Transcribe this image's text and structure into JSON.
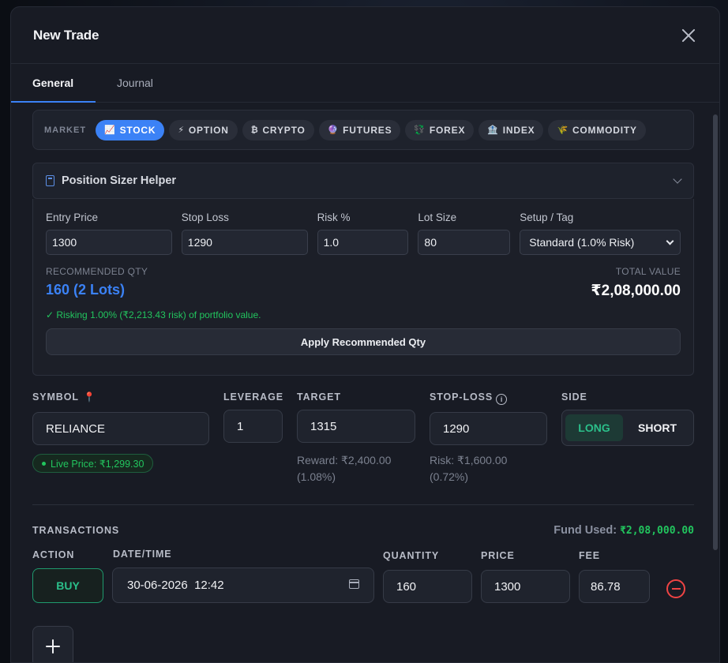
{
  "modal": {
    "title": "New Trade"
  },
  "tabs": [
    {
      "label": "General",
      "active": true
    },
    {
      "label": "Journal",
      "active": false
    }
  ],
  "market": {
    "label": "MARKET",
    "options": [
      {
        "label": "STOCK",
        "icon": "chart-icon",
        "glyph": "📈",
        "active": true
      },
      {
        "label": "OPTION",
        "icon": "lightning-icon",
        "glyph": "⚡",
        "active": false
      },
      {
        "label": "CRYPTO",
        "icon": "bitcoin-icon",
        "glyph": "₿",
        "active": false
      },
      {
        "label": "FUTURES",
        "icon": "crystal-ball-icon",
        "glyph": "🔮",
        "active": false
      },
      {
        "label": "FOREX",
        "icon": "currency-exchange-icon",
        "glyph": "💱",
        "active": false
      },
      {
        "label": "INDEX",
        "icon": "bank-icon",
        "glyph": "🏦",
        "active": false
      },
      {
        "label": "COMMODITY",
        "icon": "wheat-icon",
        "glyph": "🌾",
        "active": false
      }
    ]
  },
  "sizer": {
    "title": "Position Sizer Helper",
    "fields": {
      "entry_label": "Entry Price",
      "entry_value": "1300",
      "stop_label": "Stop Loss",
      "stop_value": "1290",
      "risk_label": "Risk %",
      "risk_value": "1.0",
      "lot_label": "Lot Size",
      "lot_value": "80",
      "setup_label": "Setup / Tag",
      "setup_value": "Standard (1.0% Risk)"
    },
    "recommended_label": "RECOMMENDED QTY",
    "recommended_value": "160 (2 Lots)",
    "total_label": "TOTAL VALUE",
    "total_value": "₹2,08,000.00",
    "risk_note": "✓ Risking 1.00% (₹2,213.43 risk) of portfolio value.",
    "apply_label": "Apply Recommended Qty"
  },
  "trade": {
    "symbol_label": "SYMBOL",
    "symbol_value": "RELIANCE",
    "live_price": "Live Price: ₹1,299.30",
    "leverage_label": "LEVERAGE",
    "leverage_value": "1",
    "target_label": "TARGET",
    "target_value": "1315",
    "reward_note_1": "Reward: ₹2,400.00",
    "reward_note_2": "(1.08%)",
    "stoploss_label": "STOP-LOSS",
    "stoploss_value": "1290",
    "risk_note_1": "Risk: ₹1,600.00",
    "risk_note_2": "(0.72%)",
    "side_label": "SIDE",
    "side_long": "LONG",
    "side_short": "SHORT",
    "side_selected": "LONG"
  },
  "transactions": {
    "title": "TRANSACTIONS",
    "fund_used_label": "Fund Used:",
    "fund_used_value": "₹2,08,000.00",
    "headers": {
      "action": "ACTION",
      "datetime": "DATE/TIME",
      "quantity": "QUANTITY",
      "price": "PRICE",
      "fee": "FEE"
    },
    "rows": [
      {
        "action": "BUY",
        "datetime": "30-06-2026  12:42",
        "quantity": "160",
        "price": "1300",
        "fee": "86.78"
      }
    ]
  },
  "colors": {
    "accent": "#3b82f6",
    "success": "#22c55e",
    "danger": "#ef4444",
    "long_green": "#2bbf8a"
  }
}
